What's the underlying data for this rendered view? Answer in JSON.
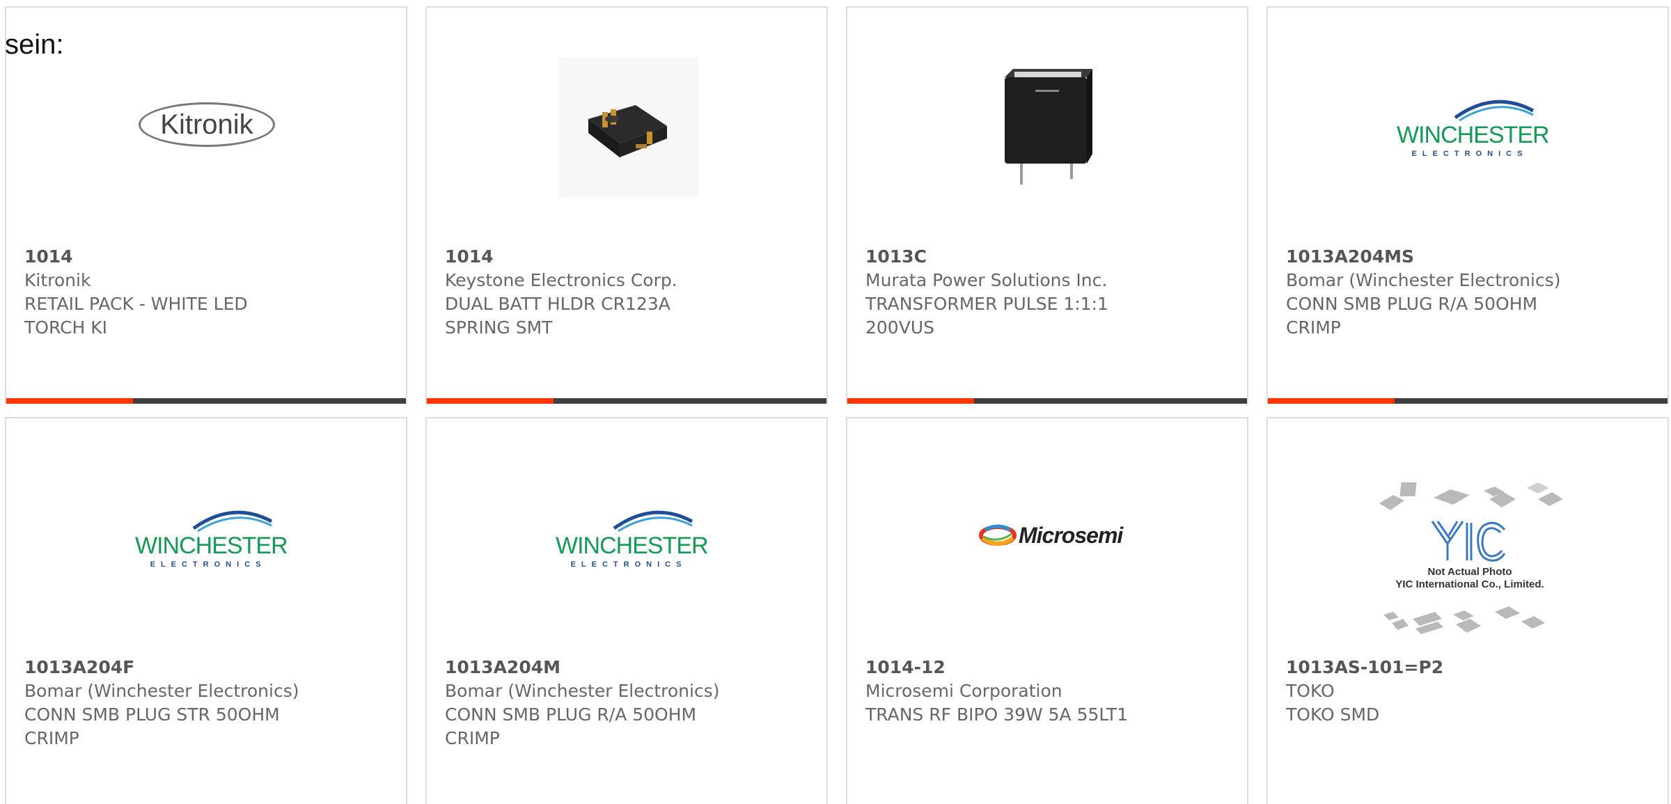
{
  "intro_text": "sein:",
  "accent_color": "#ff3300",
  "bar_color": "#3f3f3f",
  "products": [
    {
      "part_number": "1014",
      "manufacturer": "Kitronik",
      "desc_line1": "RETAIL PACK - WHITE LED",
      "desc_line2": "TORCH KI",
      "image": {
        "type": "logo",
        "text": "Kitronik"
      }
    },
    {
      "part_number": "1014",
      "manufacturer": "Keystone Electronics Corp.",
      "desc_line1": "DUAL BATT HLDR CR123A",
      "desc_line2": "SPRING SMT",
      "image": {
        "type": "product-photo",
        "name": "battery-holder"
      }
    },
    {
      "part_number": "1013C",
      "manufacturer": "Murata Power Solutions Inc.",
      "desc_line1": "TRANSFORMER PULSE 1:1:1",
      "desc_line2": "200VUS",
      "image": {
        "type": "product-photo",
        "name": "transformer"
      }
    },
    {
      "part_number": "1013A204MS",
      "manufacturer": "Bomar (Winchester Electronics)",
      "desc_line1": "CONN SMB PLUG R/A 50OHM",
      "desc_line2": "CRIMP",
      "image": {
        "type": "logo",
        "text": "WINCHESTER",
        "subtext": "ELECTRONICS"
      }
    },
    {
      "part_number": "1013A204F",
      "manufacturer": "Bomar (Winchester Electronics)",
      "desc_line1": "CONN SMB PLUG STR 50OHM",
      "desc_line2": "CRIMP",
      "image": {
        "type": "logo",
        "text": "WINCHESTER",
        "subtext": "ELECTRONICS"
      }
    },
    {
      "part_number": "1013A204M",
      "manufacturer": "Bomar (Winchester Electronics)",
      "desc_line1": "CONN SMB PLUG R/A 50OHM",
      "desc_line2": "CRIMP",
      "image": {
        "type": "logo",
        "text": "WINCHESTER",
        "subtext": "ELECTRONICS"
      }
    },
    {
      "part_number": "1014-12",
      "manufacturer": "Microsemi Corporation",
      "desc_line1": "TRANS RF BIPO 39W 5A 55LT1",
      "desc_line2": "",
      "image": {
        "type": "logo",
        "text": "Microsemi"
      }
    },
    {
      "part_number": "1013AS-101=P2",
      "manufacturer": "TOKO",
      "desc_line1": "TOKO SMD",
      "desc_line2": "",
      "image": {
        "type": "placeholder",
        "caption_line1": "Not Actual Photo",
        "caption_line2": "YIC International Co., Limited."
      }
    }
  ]
}
